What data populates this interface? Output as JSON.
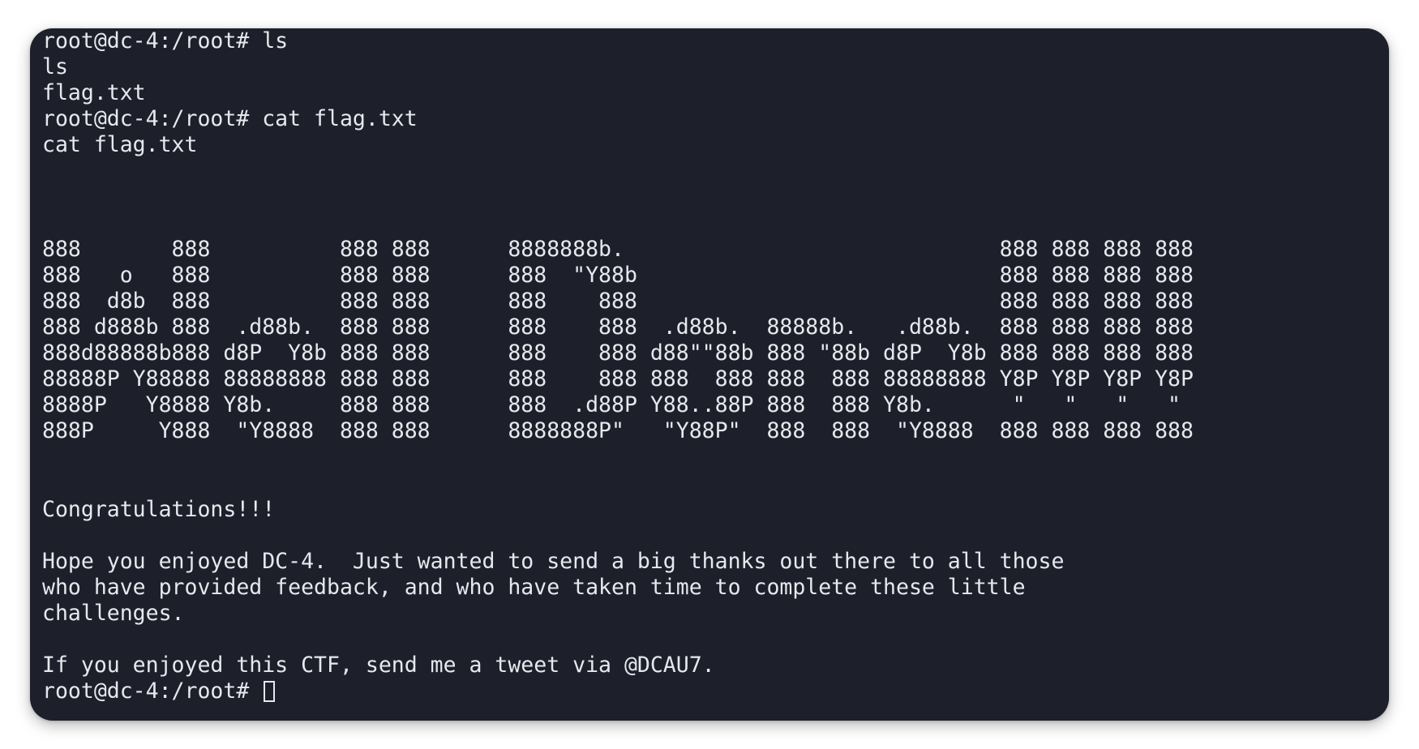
{
  "terminal": {
    "lines": [
      "root@dc-4:/root# ls",
      "ls",
      "flag.txt",
      "root@dc-4:/root# cat flag.txt",
      "cat flag.txt",
      "",
      "",
      "",
      "888       888          888 888      8888888b.                             888 888 888 888",
      "888   o   888          888 888      888  \"Y88b                            888 888 888 888",
      "888  d8b  888          888 888      888    888                            888 888 888 888",
      "888 d888b 888  .d88b.  888 888      888    888  .d88b.  88888b.   .d88b.  888 888 888 888",
      "888d88888b888 d8P  Y8b 888 888      888    888 d88\"\"88b 888 \"88b d8P  Y8b 888 888 888 888",
      "88888P Y88888 88888888 888 888      888    888 888  888 888  888 88888888 Y8P Y8P Y8P Y8P",
      "8888P   Y8888 Y8b.     888 888      888  .d88P Y88..88P 888  888 Y8b.      \"   \"   \"   \"",
      "888P     Y888  \"Y8888  888 888      8888888P\"   \"Y88P\"  888  888  \"Y8888  888 888 888 888",
      "",
      "",
      "Congratulations!!!",
      "",
      "Hope you enjoyed DC-4.  Just wanted to send a big thanks out there to all those",
      "who have provided feedback, and who have taken time to complete these little",
      "challenges.",
      "",
      "If you enjoyed this CTF, send me a tweet via @DCAU7."
    ],
    "prompt": "root@dc-4:/root# "
  }
}
